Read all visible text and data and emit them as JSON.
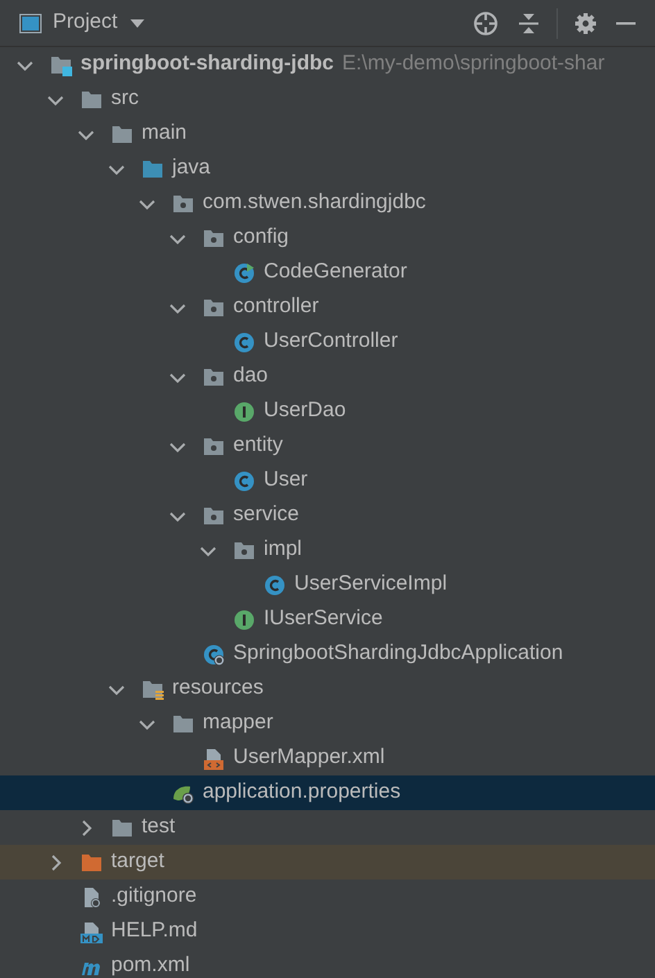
{
  "panel": {
    "title": "Project"
  },
  "tree": [
    {
      "name": "springboot-sharding-jdbc",
      "path": "E:\\my-demo\\springboot-shar",
      "kind": "module",
      "expanded": true,
      "selected": false,
      "children": [
        {
          "name": "src",
          "kind": "folder",
          "expanded": true,
          "selected": false,
          "children": [
            {
              "name": "main",
              "kind": "folder",
              "expanded": true,
              "selected": false,
              "children": [
                {
                  "name": "java",
                  "kind": "source-folder",
                  "expanded": true,
                  "selected": false,
                  "children": [
                    {
                      "name": "com.stwen.shardingjdbc",
                      "kind": "package",
                      "expanded": true,
                      "selected": false,
                      "children": [
                        {
                          "name": "config",
                          "kind": "package",
                          "expanded": true,
                          "selected": false,
                          "children": [
                            {
                              "name": "CodeGenerator",
                              "kind": "runnable-class",
                              "selected": false
                            }
                          ]
                        },
                        {
                          "name": "controller",
                          "kind": "package",
                          "expanded": true,
                          "selected": false,
                          "children": [
                            {
                              "name": "UserController",
                              "kind": "class",
                              "selected": false
                            }
                          ]
                        },
                        {
                          "name": "dao",
                          "kind": "package",
                          "expanded": true,
                          "selected": false,
                          "children": [
                            {
                              "name": "UserDao",
                              "kind": "interface",
                              "selected": false
                            }
                          ]
                        },
                        {
                          "name": "entity",
                          "kind": "package",
                          "expanded": true,
                          "selected": false,
                          "children": [
                            {
                              "name": "User",
                              "kind": "class",
                              "selected": false
                            }
                          ]
                        },
                        {
                          "name": "service",
                          "kind": "package",
                          "expanded": true,
                          "selected": false,
                          "children": [
                            {
                              "name": "impl",
                              "kind": "package",
                              "expanded": true,
                              "selected": false,
                              "children": [
                                {
                                  "name": "UserServiceImpl",
                                  "kind": "class",
                                  "selected": false
                                }
                              ]
                            },
                            {
                              "name": "IUserService",
                              "kind": "interface",
                              "selected": false
                            }
                          ]
                        },
                        {
                          "name": "SpringbootShardingJdbcApplication",
                          "kind": "spring-class",
                          "selected": false
                        }
                      ]
                    }
                  ]
                },
                {
                  "name": "resources",
                  "kind": "resource-folder",
                  "expanded": true,
                  "selected": false,
                  "children": [
                    {
                      "name": "mapper",
                      "kind": "folder",
                      "expanded": true,
                      "selected": false,
                      "children": [
                        {
                          "name": "UserMapper.xml",
                          "kind": "xml",
                          "selected": false
                        }
                      ]
                    },
                    {
                      "name": "application.properties",
                      "kind": "properties",
                      "selected": true
                    }
                  ]
                }
              ]
            },
            {
              "name": "test",
              "kind": "folder",
              "expanded": false,
              "selected": false
            }
          ]
        },
        {
          "name": "target",
          "kind": "excluded-folder",
          "expanded": false,
          "selected": false
        },
        {
          "name": ".gitignore",
          "kind": "gitignore",
          "selected": false
        },
        {
          "name": "HELP.md",
          "kind": "markdown",
          "selected": false
        },
        {
          "name": "pom.xml",
          "kind": "maven",
          "selected": false
        }
      ]
    }
  ]
}
